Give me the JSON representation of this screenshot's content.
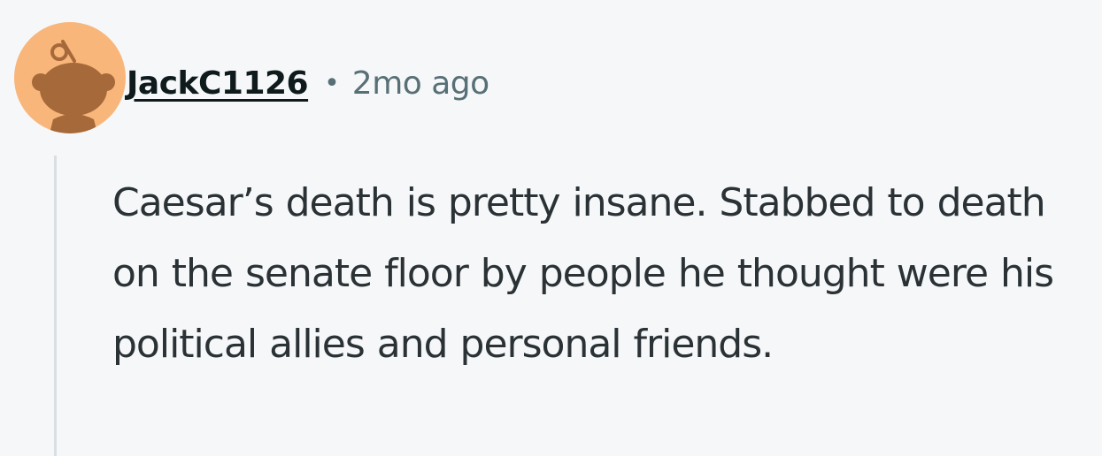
{
  "comment": {
    "avatar_icon": "reddit-snoo-avatar",
    "username": "JackC1126",
    "separator": "•",
    "timestamp": "2mo ago",
    "body": "Caesar’s death is pretty insane. Stabbed to death on the senate floor by people he thought were his political allies and personal friends."
  },
  "colors": {
    "background": "#f6f7f8",
    "avatar_bg": "#f9b67a",
    "snoo": "#a6693a",
    "username": "#0f1a1c",
    "meta": "#576f76",
    "text": "#2a3236",
    "thread_line": "#d9dee3"
  }
}
